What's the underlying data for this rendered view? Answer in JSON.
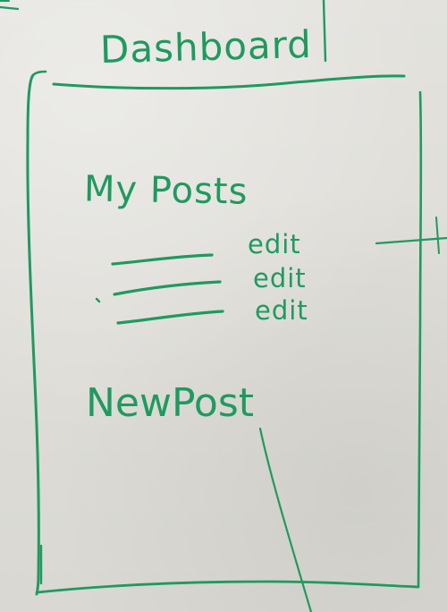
{
  "header": {
    "title": "Dashboard"
  },
  "main": {
    "section_title": "My Posts",
    "posts": [
      {
        "edit_label": "edit"
      },
      {
        "edit_label": "edit"
      },
      {
        "edit_label": "edit"
      }
    ],
    "new_post_label": "NewPost"
  },
  "colors": {
    "ink": "#1f9a5f",
    "board": "#deddd7"
  }
}
